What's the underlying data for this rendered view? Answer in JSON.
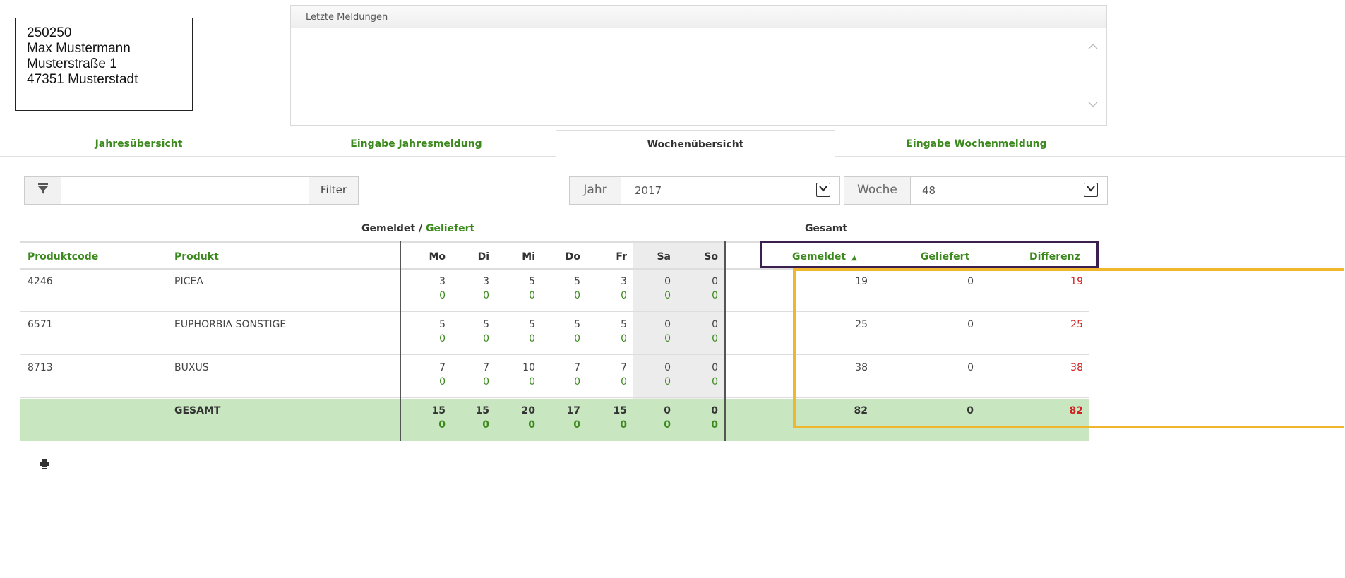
{
  "address": {
    "lines": [
      "250250",
      "Max Mustermann",
      "Musterstraße 1",
      "47351 Musterstadt"
    ]
  },
  "messages": {
    "title": "Letzte Meldungen"
  },
  "tabs": [
    {
      "label": "Jahresübersicht"
    },
    {
      "label": "Eingabe Jahresmeldung"
    },
    {
      "label": "Wochenübersicht",
      "active": true
    },
    {
      "label": "Eingabe Wochenmeldung"
    }
  ],
  "filter": {
    "input_value": "",
    "button_label": "Filter",
    "icon": "filter-icon"
  },
  "year_select": {
    "label": "Jahr",
    "value": "2017"
  },
  "week_select": {
    "label": "Woche",
    "value": "48"
  },
  "table": {
    "group_headers": {
      "reported": "Gemeldet",
      "separator": " / ",
      "delivered": "Geliefert",
      "total": "Gesamt"
    },
    "columns": {
      "code": "Produktcode",
      "product": "Produkt",
      "days": [
        "Mo",
        "Di",
        "Mi",
        "Do",
        "Fr",
        "Sa",
        "So"
      ],
      "reported": "Gemeldet",
      "delivered": "Geliefert",
      "difference": "Differenz"
    },
    "sort_indicator": "▲",
    "rows": [
      {
        "code": "4246",
        "product": "PICEA",
        "reported": [
          "3",
          "3",
          "5",
          "5",
          "3",
          "0",
          "0"
        ],
        "delivered": [
          "0",
          "0",
          "0",
          "0",
          "0",
          "0",
          "0"
        ],
        "total_reported": "19",
        "total_delivered": "0",
        "difference": "19"
      },
      {
        "code": "6571",
        "product": "EUPHORBIA SONSTIGE",
        "reported": [
          "5",
          "5",
          "5",
          "5",
          "5",
          "0",
          "0"
        ],
        "delivered": [
          "0",
          "0",
          "0",
          "0",
          "0",
          "0",
          "0"
        ],
        "total_reported": "25",
        "total_delivered": "0",
        "difference": "25"
      },
      {
        "code": "8713",
        "product": "BUXUS",
        "reported": [
          "7",
          "7",
          "10",
          "7",
          "7",
          "0",
          "0"
        ],
        "delivered": [
          "0",
          "0",
          "0",
          "0",
          "0",
          "0",
          "0"
        ],
        "total_reported": "38",
        "total_delivered": "0",
        "difference": "38"
      }
    ],
    "total": {
      "label": "GESAMT",
      "reported": [
        "15",
        "15",
        "20",
        "17",
        "15",
        "0",
        "0"
      ],
      "delivered": [
        "0",
        "0",
        "0",
        "0",
        "0",
        "0",
        "0"
      ],
      "total_reported": "82",
      "total_delivered": "0",
      "difference": "82"
    }
  },
  "print": {
    "icon": "printer-icon"
  },
  "colors": {
    "accent_green": "#3c8a1e",
    "total_row_bg": "#c8e6c0",
    "difference_red": "#d02020",
    "highlight_purple": "#3a1f4f",
    "highlight_orange": "#f0b62d"
  }
}
